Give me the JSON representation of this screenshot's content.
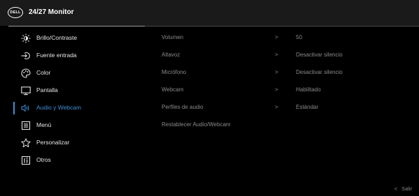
{
  "header": {
    "logo_text": "DELL",
    "title": "24/27 Monitor"
  },
  "sidebar": {
    "items": [
      {
        "label": "Brillo/Contraste",
        "icon": "brightness-icon"
      },
      {
        "label": "Fuente entrada",
        "icon": "input-source-icon"
      },
      {
        "label": "Color",
        "icon": "color-palette-icon"
      },
      {
        "label": "Pantalla",
        "icon": "display-icon"
      },
      {
        "label": "Audio y Webcam",
        "icon": "speaker-icon",
        "active": true
      },
      {
        "label": "Menú",
        "icon": "menu-icon"
      },
      {
        "label": "Personalizar",
        "icon": "star-icon"
      },
      {
        "label": "Otros",
        "icon": "info-icon"
      }
    ]
  },
  "settings": {
    "rows": [
      {
        "label": "Volumen",
        "value": "50",
        "chevron": ">"
      },
      {
        "label": "Altavoz",
        "value": "Desactivar silencio",
        "chevron": ">"
      },
      {
        "label": "Micrófono",
        "value": "Desactivar silencio",
        "chevron": ">"
      },
      {
        "label": "Webcam",
        "value": "Habilitado",
        "chevron": ">"
      },
      {
        "label": "Perfiles de audio",
        "value": "Estándar",
        "chevron": ">"
      },
      {
        "label": "Restablecer Audio/Webcam",
        "value": "",
        "chevron": ""
      }
    ]
  },
  "footer": {
    "exit_chevron": "<",
    "exit_label": "Salir"
  },
  "colors": {
    "accent": "#3d8fd6",
    "text": "#e6e6e6",
    "muted": "#8a8a8a",
    "header_bg": "#1a1a1a"
  }
}
